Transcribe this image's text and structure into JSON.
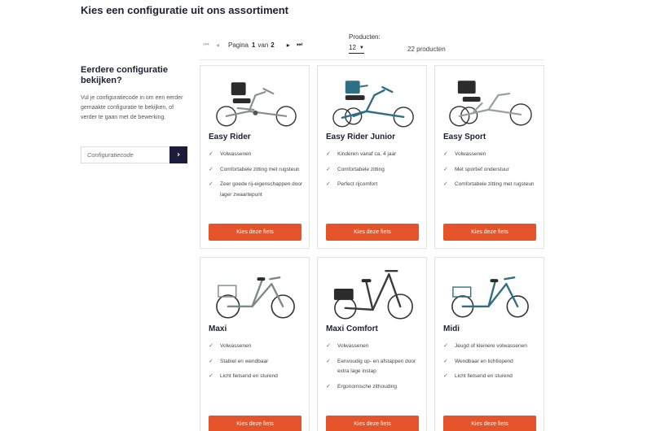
{
  "page": {
    "title": "Kies een configuratie uit ons assortiment"
  },
  "pagination": {
    "first_icon": "⏮",
    "prev_icon": "◂",
    "label": "Pagina",
    "current": "1",
    "separator": "van",
    "total": "2",
    "next_icon": "▸",
    "last_icon": "⏭"
  },
  "per_page": {
    "label": "Producten:",
    "value": "12",
    "caret": "▼"
  },
  "result_count": "22 producten",
  "sidebar": {
    "heading": "Eerdere configuratie bekijken?",
    "text": "Vul je configuratiecode in om een eerder gemaakte configuratie te bekijken, of verder te gaan met de bewerking.",
    "input_placeholder": "Configuratiecode",
    "submit_icon": "›"
  },
  "colors": {
    "accent": "#e4532a",
    "navy": "#1c1b3a",
    "frame_gray": "#7a8a86",
    "frame_blue": "#2f6f86"
  },
  "check_icon": "✓",
  "products": [
    {
      "name": "Easy Rider",
      "features": [
        "Volwassenen",
        "Comfortabele zitting met rugsteun",
        "Zeer goede rij-eigenschappen door lager zwaartepunt"
      ],
      "cta": "Kies deze fiets",
      "icon": "recumbent-trike-icon"
    },
    {
      "name": "Easy Rider Junior",
      "features": [
        "Kinderen vanaf ca. 4 jaar",
        "Comfortabele zitting",
        "Perfect rijcomfort"
      ],
      "cta": "Kies deze fiets",
      "icon": "junior-trike-icon"
    },
    {
      "name": "Easy Sport",
      "features": [
        "Volwassenen",
        "Met sportief onderstuur",
        "Comfortabele zitting met rugsteun"
      ],
      "cta": "Kies deze fiets",
      "icon": "sport-trike-icon"
    },
    {
      "name": "Maxi",
      "features": [
        "Volwassenen",
        "Stabiel en wendbaar",
        "Licht fietsend en sturend"
      ],
      "cta": "Kies deze fiets",
      "icon": "tricycle-icon"
    },
    {
      "name": "Maxi Comfort",
      "features": [
        "Volwassenen",
        "Eenvoudig op- en afstappen door extra lage instap",
        "Ergonomische zithouding"
      ],
      "cta": "Kies deze fiets",
      "icon": "low-step-tricycle-icon"
    },
    {
      "name": "Midi",
      "features": [
        "Jeugd of kleinere volwassenen",
        "Wendbaar en lichtlopend",
        "Licht fietsend en sturend"
      ],
      "cta": "Kies deze fiets",
      "icon": "youth-tricycle-icon"
    }
  ]
}
